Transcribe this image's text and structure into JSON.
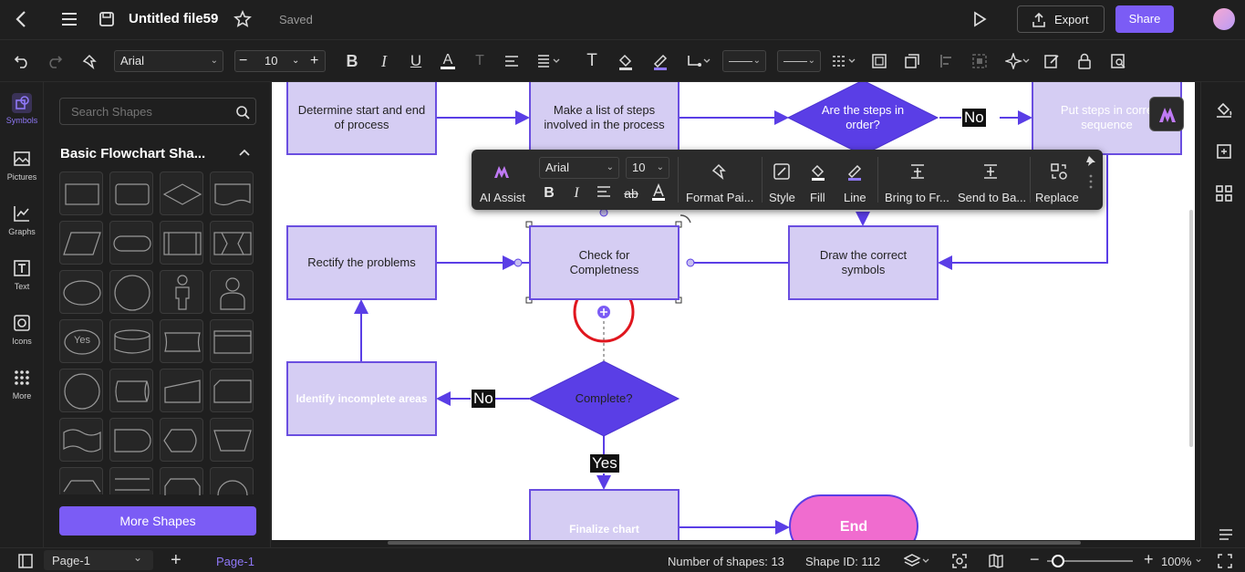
{
  "app": {
    "file_title": "Untitled file59",
    "save_status": "Saved",
    "export_label": "Export",
    "share_label": "Share",
    "accent": "#7b5cf5"
  },
  "toolbar": {
    "font_family": "Arial",
    "font_size": "10",
    "text_tool_label": "T"
  },
  "rail": {
    "items": [
      {
        "label": "Symbols",
        "icon": "shapes-icon"
      },
      {
        "label": "Pictures",
        "icon": "image-icon"
      },
      {
        "label": "Graphs",
        "icon": "chart-icon"
      },
      {
        "label": "Text",
        "icon": "text-icon"
      },
      {
        "label": "Icons",
        "icon": "icons-icon"
      },
      {
        "label": "More",
        "icon": "grid-icon"
      }
    ]
  },
  "panel": {
    "search_placeholder": "Search Shapes",
    "section_title": "Basic Flowchart Sha...",
    "yes_shape_text": "Yes",
    "more_shapes_label": "More Shapes"
  },
  "canvas": {
    "nodes": {
      "determine": "Determine start and end of process",
      "make_list": "Make a list of steps involved in the process",
      "in_order": "Are the steps in order?",
      "put_steps": "Put steps in corre sequence",
      "rectify": "Rectify the problems",
      "check": "Check for Completness",
      "draw": "Draw the correct symbols",
      "identify": "Identify incomplete areas",
      "complete": "Complete?",
      "finalize": "Finalize chart",
      "end": "End"
    },
    "labels": {
      "no_top": "No",
      "no_mid": "No",
      "yes": "Yes"
    }
  },
  "floating_toolbar": {
    "ai_assist": "AI Assist",
    "font_family": "Arial",
    "font_size": "10",
    "format_painter": "Format Pai...",
    "style": "Style",
    "fill": "Fill",
    "line": "Line",
    "bring_front": "Bring to Fr...",
    "send_back": "Send to Ba...",
    "replace": "Replace",
    "ab": "ab"
  },
  "status": {
    "page_select": "Page-1",
    "page_tab": "Page-1",
    "shape_count": "Number of shapes: 13",
    "shape_id": "Shape ID: 112",
    "zoom": "100%"
  }
}
